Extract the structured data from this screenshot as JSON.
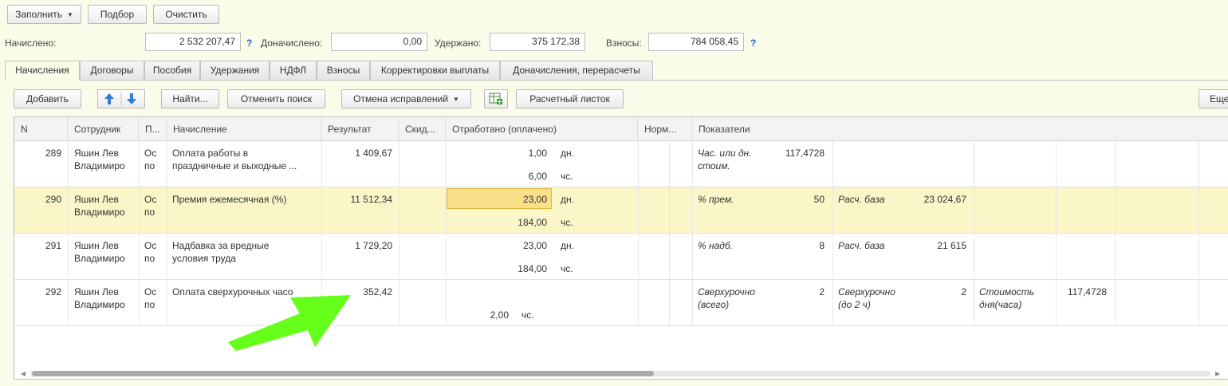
{
  "toolbar": {
    "fill_label": "Заполнить",
    "select_label": "Подбор",
    "clear_label": "Очистить"
  },
  "totals": {
    "accrued_label": "Начислено:",
    "accrued_value": "2 532 207,47",
    "additional_label": "Доначислено:",
    "additional_value": "0,00",
    "withheld_label": "Удержано:",
    "withheld_value": "375 172,38",
    "contrib_label": "Взносы:",
    "contrib_value": "784 058,45",
    "help": "?"
  },
  "tabs": [
    "Начисления",
    "Договоры",
    "Пособия",
    "Удержания",
    "НДФЛ",
    "Взносы",
    "Корректировки выплаты",
    "Доначисления, перерасчеты"
  ],
  "grid_toolbar": {
    "add_label": "Добавить",
    "find_label": "Найти...",
    "cancel_search_label": "Отменить поиск",
    "corrections_label": "Отмена исправлений",
    "payslip_label": "Расчетный листок",
    "more_label": "Еще"
  },
  "columns": [
    "N",
    "Сотрудник",
    "П...",
    "Начисление",
    "Результат",
    "Скид...",
    "Отработано (оплачено)",
    "Норм...",
    "Показатели"
  ],
  "rows": [
    {
      "n": "289",
      "emp1": "Яшин Лев",
      "emp2": "Владимиро",
      "p1": "Ос",
      "p2": "по",
      "acc1": "Оплата работы в",
      "acc2": "праздничные и выходные ...",
      "result": "1 409,67",
      "worked1": "1,00",
      "unit1": "дн.",
      "worked2": "6,00",
      "unit2": "чс.",
      "ind1_name": "Час. или дн. стоим.",
      "ind1_val": "117,4728"
    },
    {
      "n": "290",
      "emp1": "Яшин Лев",
      "emp2": "Владимиро",
      "p1": "Ос",
      "p2": "по",
      "acc1": "Премия ежемесячная (%)",
      "acc2": "",
      "result": "11 512,34",
      "worked1": "23,00",
      "unit1": "дн.",
      "worked2": "184,00",
      "unit2": "чс.",
      "ind1_name": "% прем.",
      "ind1_val": "50",
      "ind2_name": "Расч. база",
      "ind2_val": "23 024,67"
    },
    {
      "n": "291",
      "emp1": "Яшин Лев",
      "emp2": "Владимиро",
      "p1": "Ос",
      "p2": "по",
      "acc1": "Надбавка за вредные",
      "acc2": "условия труда",
      "result": "1 729,20",
      "worked1": "23,00",
      "unit1": "дн.",
      "worked2": "184,00",
      "unit2": "чс.",
      "ind1_name": "% надб.",
      "ind1_val": "8",
      "ind2_name": "Расч. база",
      "ind2_val": "21 615"
    },
    {
      "n": "292",
      "emp1": "Яшин Лев",
      "emp2": "Владимиро",
      "p1": "Ос",
      "p2": "по",
      "acc1": "Оплата сверхурочных часо",
      "acc2": "",
      "result": "352,42",
      "worked2": "2,00",
      "unit2": "чс.",
      "ind1_name": "Сверхурочно (всего)",
      "ind1_val": "2",
      "ind2_name": "Сверхурочно (до 2 ч)",
      "ind2_val": "2",
      "ind3_name": "Стоимость дня(часа)",
      "ind3_val": "117,4728"
    }
  ],
  "colors": {
    "background": "#fbfbea",
    "selected_row": "#faf6c8",
    "edit_cell": "#f8df88",
    "annotation_arrow": "#66ff1a"
  }
}
